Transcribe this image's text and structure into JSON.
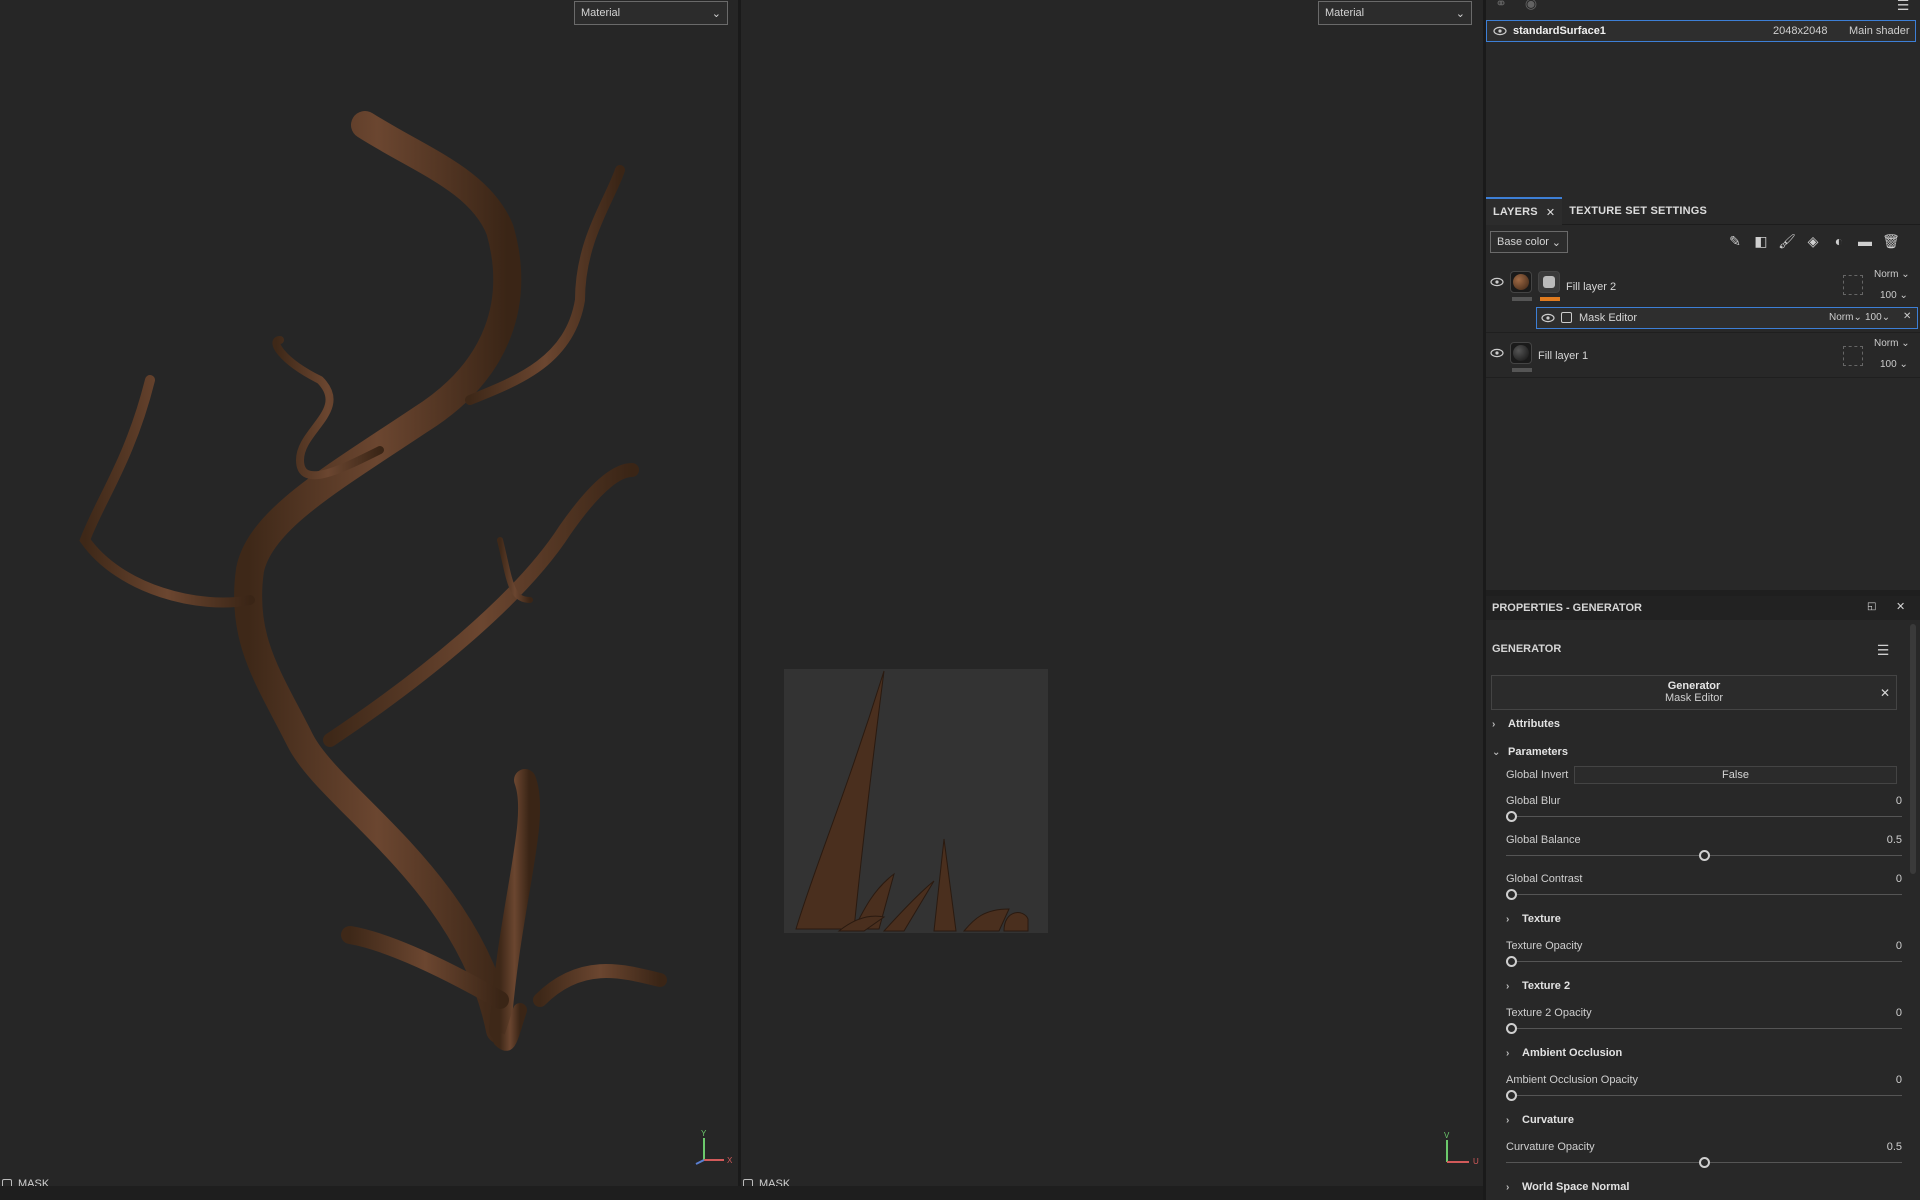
{
  "viewport_3d": {
    "mode_select": "Material",
    "bottom_label": "MASK",
    "axis_labels": {
      "y": "Y",
      "x": "X"
    }
  },
  "viewport_2d": {
    "mode_select": "Material",
    "bottom_label": "MASK",
    "axis_labels": {
      "v": "V",
      "u": "U"
    }
  },
  "texture_sets": {
    "row": {
      "name": "standardSurface1",
      "resolution": "2048x2048",
      "shader": "Main shader"
    }
  },
  "layers_panel": {
    "tabs": [
      {
        "label": "LAYERS"
      },
      {
        "label": "TEXTURE SET SETTINGS"
      }
    ],
    "channel_select": "Base color",
    "layers": [
      {
        "name": "Fill layer 2",
        "blend": "Norm",
        "opacity": "100"
      },
      {
        "name": "Mask Editor",
        "blend": "Norm",
        "opacity": "100"
      },
      {
        "name": "Fill layer 1",
        "blend": "Norm",
        "opacity": "100"
      }
    ]
  },
  "properties": {
    "header": "PROPERTIES - GENERATOR",
    "section_title": "GENERATOR",
    "generator_box": {
      "title": "Generator",
      "subtitle": "Mask Editor"
    },
    "attributes_label": "Attributes",
    "parameters_label": "Parameters",
    "global_invert": {
      "label": "Global Invert",
      "value": "False"
    },
    "sliders": [
      {
        "label": "Global Blur",
        "value": "0",
        "fraction": 0
      },
      {
        "label": "Global Balance",
        "value": "0.5",
        "fraction": 0.5
      },
      {
        "label": "Global Contrast",
        "value": "0",
        "fraction": 0
      }
    ],
    "groups": [
      {
        "label": "Texture",
        "slider_label": "Texture Opacity",
        "value": "0",
        "fraction": 0
      },
      {
        "label": "Texture 2",
        "slider_label": "Texture 2 Opacity",
        "value": "0",
        "fraction": 0
      },
      {
        "label": "Ambient Occlusion",
        "slider_label": "Ambient Occlusion Opacity",
        "value": "0",
        "fraction": 0
      },
      {
        "label": "Curvature",
        "slider_label": "Curvature Opacity",
        "value": "0.5",
        "fraction": 0.5
      }
    ],
    "last_group": "World Space Normal"
  },
  "colors": {
    "accent": "#3d7fd6",
    "orange_mask": "#e07b1f",
    "bark": "#5a3a24"
  }
}
